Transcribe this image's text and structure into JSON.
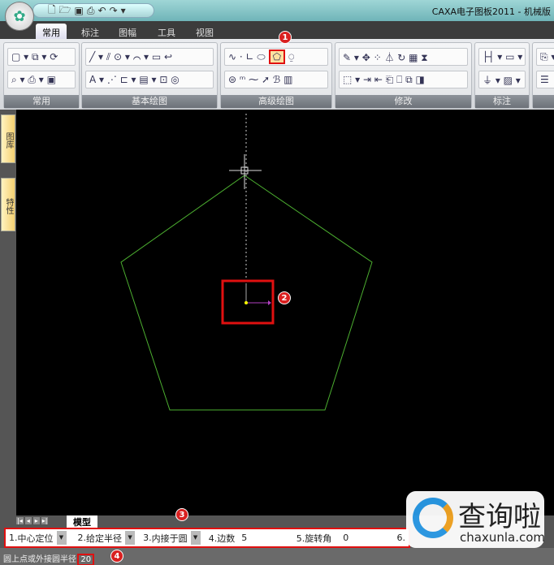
{
  "window": {
    "title": "CAXA电子图板2011 - 机械版"
  },
  "quick_access": {
    "icons": [
      "new",
      "open",
      "save",
      "print",
      "undo",
      "redo"
    ],
    "more": "▾"
  },
  "tabs": [
    {
      "label": "常用",
      "active": true
    },
    {
      "label": "标注"
    },
    {
      "label": "图幅"
    },
    {
      "label": "工具"
    },
    {
      "label": "视图"
    }
  ],
  "ribbon": {
    "groups": [
      {
        "label": "常用",
        "row1": "▢ ▾ ⧉ ▾ ⟳",
        "row2": "⌕ ▾ ⎙ ▾ ▣"
      },
      {
        "label": "基本绘图",
        "row1": "╱ ▾ ⫽ ⊙ ▾ ⌒ ▾ ▭ ↩",
        "row2": "A ▾ ⋰ ⊏ ▾ ▤ ▾ ⊡ ◎"
      },
      {
        "label": "高级绘图",
        "row1": "∿ · ∟ ⬭",
        "row2": "⊜ ᵐ ⁓ ➚ ℬ ▥",
        "row1b": "⍜"
      },
      {
        "label": "修改",
        "row1": "✎ ▾ ✥ ⁘ ⏃ ↻ ▦ ⧗",
        "row2": "⬚ ▾ ⇥ ⇤ ⎗ ⎕ ⧉ ◨"
      },
      {
        "label": "标注",
        "row1": "├┤ ▾ ▭ ▾",
        "row2": "⏚ ▾ ▨ ▾"
      },
      {
        "label": "",
        "row1": "⎘ ▾",
        "row2": "☰"
      }
    ]
  },
  "polygon_tool_icon": "⬠",
  "badges": [
    "1",
    "2",
    "3",
    "4"
  ],
  "side_tabs": [
    "图库",
    "特性"
  ],
  "model_tab": {
    "nav": [
      "|◂",
      "◂",
      "▸",
      "▸|"
    ],
    "label": "模型"
  },
  "options": [
    {
      "num": "1.",
      "value": "中心定位"
    },
    {
      "num": "2.",
      "value": "给定半径"
    },
    {
      "num": "3.",
      "value": "内接于圆"
    },
    {
      "label": "4.边数",
      "value": "5"
    },
    {
      "label": "5.旋转角",
      "value": "0"
    },
    {
      "label": "6."
    }
  ],
  "status": {
    "prompt": "圆上点或外接圆半径:",
    "value": "20"
  },
  "watermark": {
    "text": "查询啦",
    "url": "chaxunla.com"
  },
  "colors": {
    "pentagon": "#4caf30",
    "highlight": "#e01010",
    "axis_x": "#b040c0"
  }
}
